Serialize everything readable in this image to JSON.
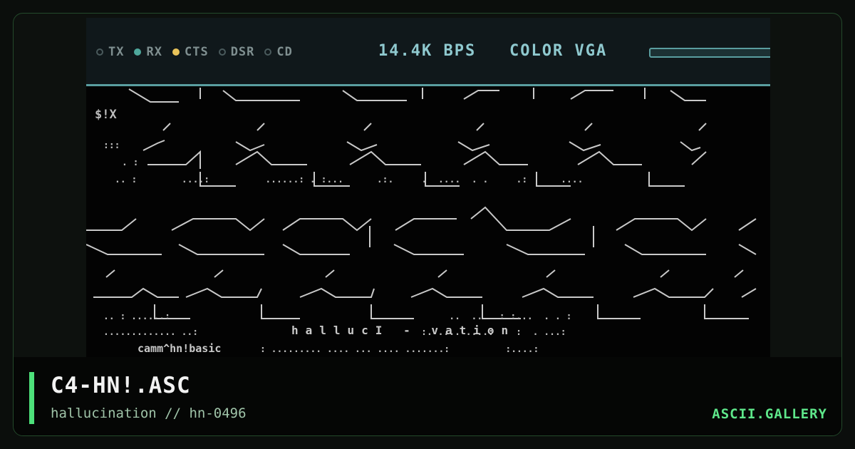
{
  "modem": {
    "leds": [
      {
        "label": "TX",
        "state": "off"
      },
      {
        "label": "RX",
        "state": "on"
      },
      {
        "label": "CTS",
        "state": "amber"
      },
      {
        "label": "DSR",
        "state": "off"
      },
      {
        "label": "CD",
        "state": "off"
      }
    ],
    "baud": "14.4K BPS",
    "mode": "COLOR VGA"
  },
  "art": {
    "edge_left": "$!X",
    "caption": "hallucI - vation",
    "signature": "camm^hn!basic"
  },
  "card": {
    "title": "C4-HN!.ASC",
    "subtitle": "hallucination // hn-0496",
    "brand": "ASCII.GALLERY"
  },
  "colors": {
    "accent": "#4de07a",
    "led_on": "#4fa89c",
    "led_amber": "#e8c35a",
    "screen_text": "#c9c9c9"
  }
}
